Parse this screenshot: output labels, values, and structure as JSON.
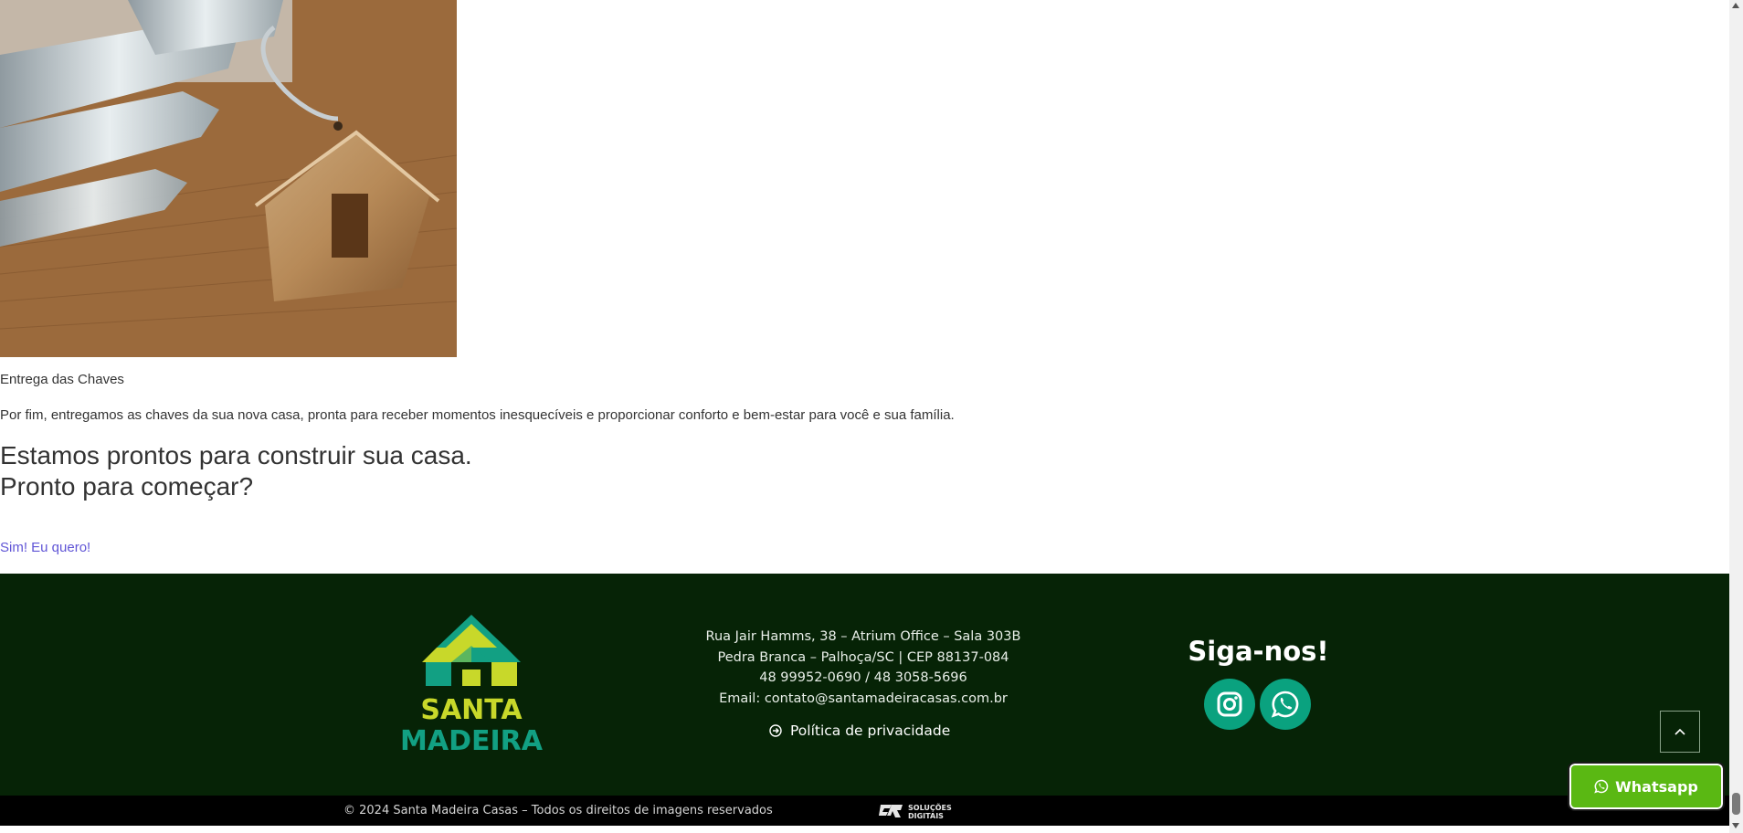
{
  "step": {
    "title": "Entrega das Chaves",
    "description": "Por fim, entregamos as chaves da sua nova casa, pronta para receber momentos inesquecíveis e proporcionar conforto e bem-estar para você e sua família."
  },
  "cta": {
    "line1": "Estamos prontos para construir sua casa.",
    "line2": "Pronto para começar?",
    "link_label": "Sim! Eu quero!"
  },
  "footer": {
    "logo_line1": "SANTA",
    "logo_line2": "MADEIRA",
    "address_lines": [
      "Rua Jair Hamms, 38 – Atrium Office – Sala 303B",
      "Pedra Branca – Palhoça/SC | CEP 88137-084",
      "48 99952-0690 / 48 3058-5696",
      "Email: contato@santamadeiracasas.com.br"
    ],
    "privacy_label": "Política de privacidade",
    "follow_title": "Siga-nos!",
    "social": [
      {
        "icon": "instagram-icon"
      },
      {
        "icon": "whatsapp-icon"
      }
    ],
    "copyright": "© 2024 Santa Madeira Casas – Todos os direitos de imagens reservados",
    "dev_logo_line1": "SOLUÇÕES",
    "dev_logo_line2": "DIGITAIS"
  },
  "floating": {
    "whatsapp_label": "Whatsapp"
  },
  "colors": {
    "footer_bg": "#062306",
    "accent_green": "#0aa27f",
    "whatsapp_green": "#5ab813",
    "link": "#6055d6",
    "logo_yellow": "#c8d82a",
    "logo_teal": "#12a083"
  }
}
